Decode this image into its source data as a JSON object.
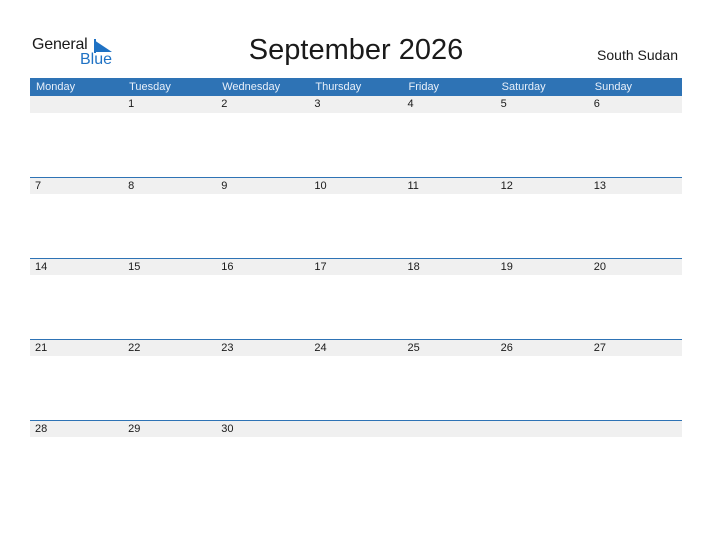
{
  "logo": {
    "part1": "General",
    "part2": "Blue"
  },
  "title": "September 2026",
  "country": "South Sudan",
  "colors": {
    "header": "#2e73b5",
    "accent": "#1f72c4",
    "strip": "#f0f0f0"
  },
  "days": [
    "Monday",
    "Tuesday",
    "Wednesday",
    "Thursday",
    "Friday",
    "Saturday",
    "Sunday"
  ],
  "weeks": [
    [
      "",
      "1",
      "2",
      "3",
      "4",
      "5",
      "6"
    ],
    [
      "7",
      "8",
      "9",
      "10",
      "11",
      "12",
      "13"
    ],
    [
      "14",
      "15",
      "16",
      "17",
      "18",
      "19",
      "20"
    ],
    [
      "21",
      "22",
      "23",
      "24",
      "25",
      "26",
      "27"
    ],
    [
      "28",
      "29",
      "30",
      "",
      "",
      "",
      ""
    ]
  ]
}
